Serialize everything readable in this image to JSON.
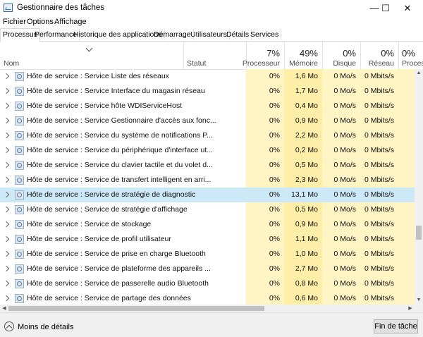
{
  "window": {
    "title": "Gestionnaire des tâches",
    "minimize": "—",
    "maximize": "☐",
    "close": "✕"
  },
  "menu": [
    "Fichier",
    "Options",
    "Affichage"
  ],
  "tabs": [
    "Processus",
    "Performance",
    "Historique des applications",
    "Démarrage",
    "Utilisateurs",
    "Détails",
    "Services"
  ],
  "active_tab": "Processus",
  "columns": {
    "name": "Nom",
    "status": "Statut",
    "cpu": {
      "pct": "7%",
      "label": "Processeur"
    },
    "memory": {
      "pct": "49%",
      "label": "Mémoire"
    },
    "disk": {
      "pct": "0%",
      "label": "Disque"
    },
    "network": {
      "pct": "0%",
      "label": "Réseau"
    },
    "proc": {
      "pct": "0%",
      "label": "Proces"
    }
  },
  "rows": [
    {
      "name": "Hôte de service : Service Liste des réseaux",
      "cpu": "0%",
      "mem": "1,6 Mo",
      "disk": "0 Mo/s",
      "net": "0 Mbits/s",
      "selected": false
    },
    {
      "name": "Hôte de service : Service Interface du magasin réseau",
      "cpu": "0%",
      "mem": "1,7 Mo",
      "disk": "0 Mo/s",
      "net": "0 Mbits/s",
      "selected": false
    },
    {
      "name": "Hôte de service : Service hôte WDIServiceHost",
      "cpu": "0%",
      "mem": "0,4 Mo",
      "disk": "0 Mo/s",
      "net": "0 Mbits/s",
      "selected": false
    },
    {
      "name": "Hôte de service : Service Gestionnaire d'accès aux fonc...",
      "cpu": "0%",
      "mem": "0,9 Mo",
      "disk": "0 Mo/s",
      "net": "0 Mbits/s",
      "selected": false
    },
    {
      "name": "Hôte de service : Service du système de notifications P...",
      "cpu": "0%",
      "mem": "2,2 Mo",
      "disk": "0 Mo/s",
      "net": "0 Mbits/s",
      "selected": false
    },
    {
      "name": "Hôte de service : Service du périphérique d'interface ut...",
      "cpu": "0%",
      "mem": "0,2 Mo",
      "disk": "0 Mo/s",
      "net": "0 Mbits/s",
      "selected": false
    },
    {
      "name": "Hôte de service : Service du clavier tactile et du volet d...",
      "cpu": "0%",
      "mem": "0,5 Mo",
      "disk": "0 Mo/s",
      "net": "0 Mbits/s",
      "selected": false
    },
    {
      "name": "Hôte de service : Service de transfert intelligent en arri...",
      "cpu": "0%",
      "mem": "2,3 Mo",
      "disk": "0 Mo/s",
      "net": "0 Mbits/s",
      "selected": false
    },
    {
      "name": "Hôte de service : Service de stratégie de diagnostic",
      "cpu": "0%",
      "mem": "13,1 Mo",
      "disk": "0 Mo/s",
      "net": "0 Mbits/s",
      "selected": true
    },
    {
      "name": "Hôte de service : Service de stratégie d'affichage",
      "cpu": "0%",
      "mem": "0,5 Mo",
      "disk": "0 Mo/s",
      "net": "0 Mbits/s",
      "selected": false
    },
    {
      "name": "Hôte de service : Service de stockage",
      "cpu": "0%",
      "mem": "0,9 Mo",
      "disk": "0 Mo/s",
      "net": "0 Mbits/s",
      "selected": false
    },
    {
      "name": "Hôte de service : Service de profil utilisateur",
      "cpu": "0%",
      "mem": "1,1 Mo",
      "disk": "0 Mo/s",
      "net": "0 Mbits/s",
      "selected": false
    },
    {
      "name": "Hôte de service : Service de prise en charge Bluetooth",
      "cpu": "0%",
      "mem": "1,0 Mo",
      "disk": "0 Mo/s",
      "net": "0 Mbits/s",
      "selected": false
    },
    {
      "name": "Hôte de service : Service de plateforme des appareils ...",
      "cpu": "0%",
      "mem": "2,7 Mo",
      "disk": "0 Mo/s",
      "net": "0 Mbits/s",
      "selected": false
    },
    {
      "name": "Hôte de service : Service de passerelle audio Bluetooth",
      "cpu": "0%",
      "mem": "0,8 Mo",
      "disk": "0 Mo/s",
      "net": "0 Mbits/s",
      "selected": false
    },
    {
      "name": "Hôte de service : Service de partage des données",
      "cpu": "0%",
      "mem": "0,6 Mo",
      "disk": "0 Mo/s",
      "net": "0 Mbits/s",
      "selected": false
    }
  ],
  "footer": {
    "less_details": "Moins de détails",
    "end_task": "Fin de tâche"
  },
  "colors": {
    "heat_light": "#fff4c4",
    "heat_medium": "#ffeea8",
    "selection": "#cde8f6"
  }
}
